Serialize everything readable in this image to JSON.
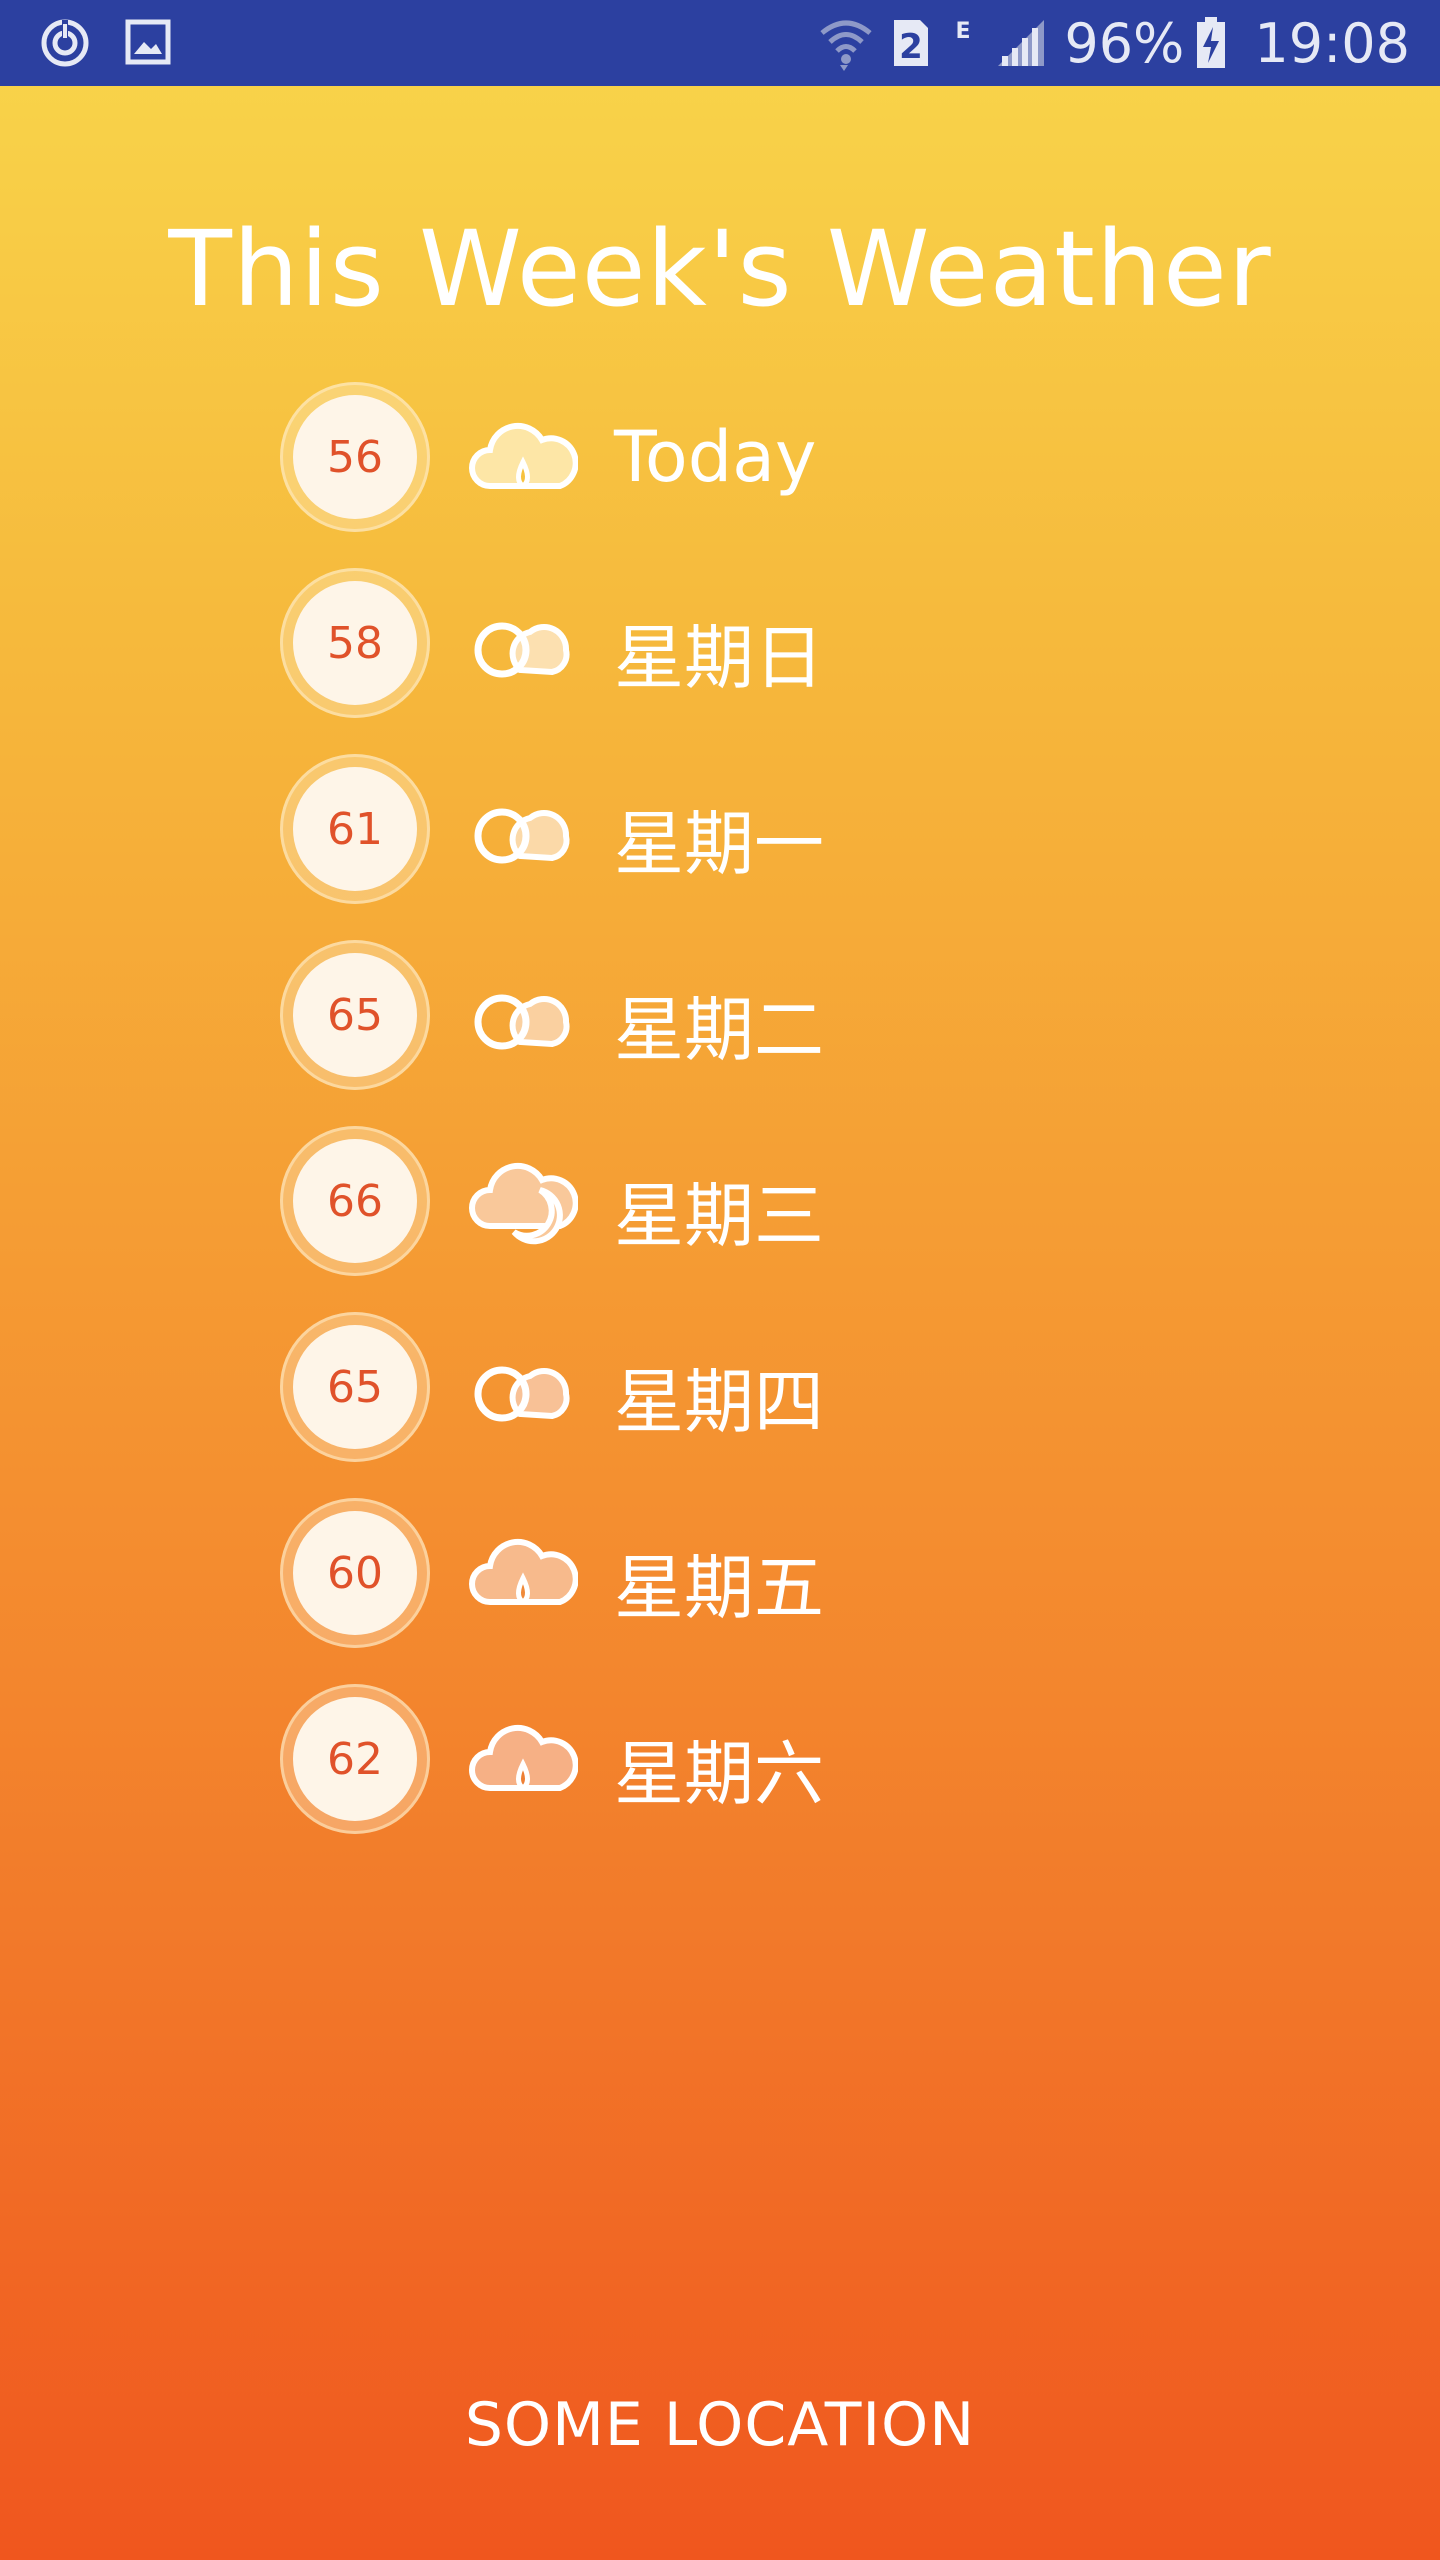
{
  "status_bar": {
    "icons_left": [
      "sync-icon",
      "image-icon"
    ],
    "icons_right": [
      "wifi-icon",
      "sim-2-icon",
      "network-e-icon",
      "signal-icon",
      "battery-charging-icon"
    ],
    "sim_label": "2",
    "network_label": "E",
    "battery": "96%",
    "time": "19:08"
  },
  "title": "This Week's Weather",
  "days": [
    {
      "temp": "56",
      "label": "Today",
      "icon": "rain-cloud-icon"
    },
    {
      "temp": "58",
      "label": "星期日",
      "icon": "cloudy-icon"
    },
    {
      "temp": "61",
      "label": "星期一",
      "icon": "cloudy-icon"
    },
    {
      "temp": "65",
      "label": "星期二",
      "icon": "cloudy-icon"
    },
    {
      "temp": "66",
      "label": "星期三",
      "icon": "cloud-moon-icon"
    },
    {
      "temp": "65",
      "label": "星期四",
      "icon": "cloudy-icon"
    },
    {
      "temp": "60",
      "label": "星期五",
      "icon": "rain-cloud-icon"
    },
    {
      "temp": "62",
      "label": "星期六",
      "icon": "rain-cloud-icon"
    }
  ],
  "location": "SOME LOCATION",
  "colors": {
    "status_bar": "#2C40A0",
    "gradient_top": "#F9D64B",
    "gradient_bottom": "#F0561E",
    "temp_text": "#E0522A",
    "temp_circle": "#FEF5E8"
  }
}
